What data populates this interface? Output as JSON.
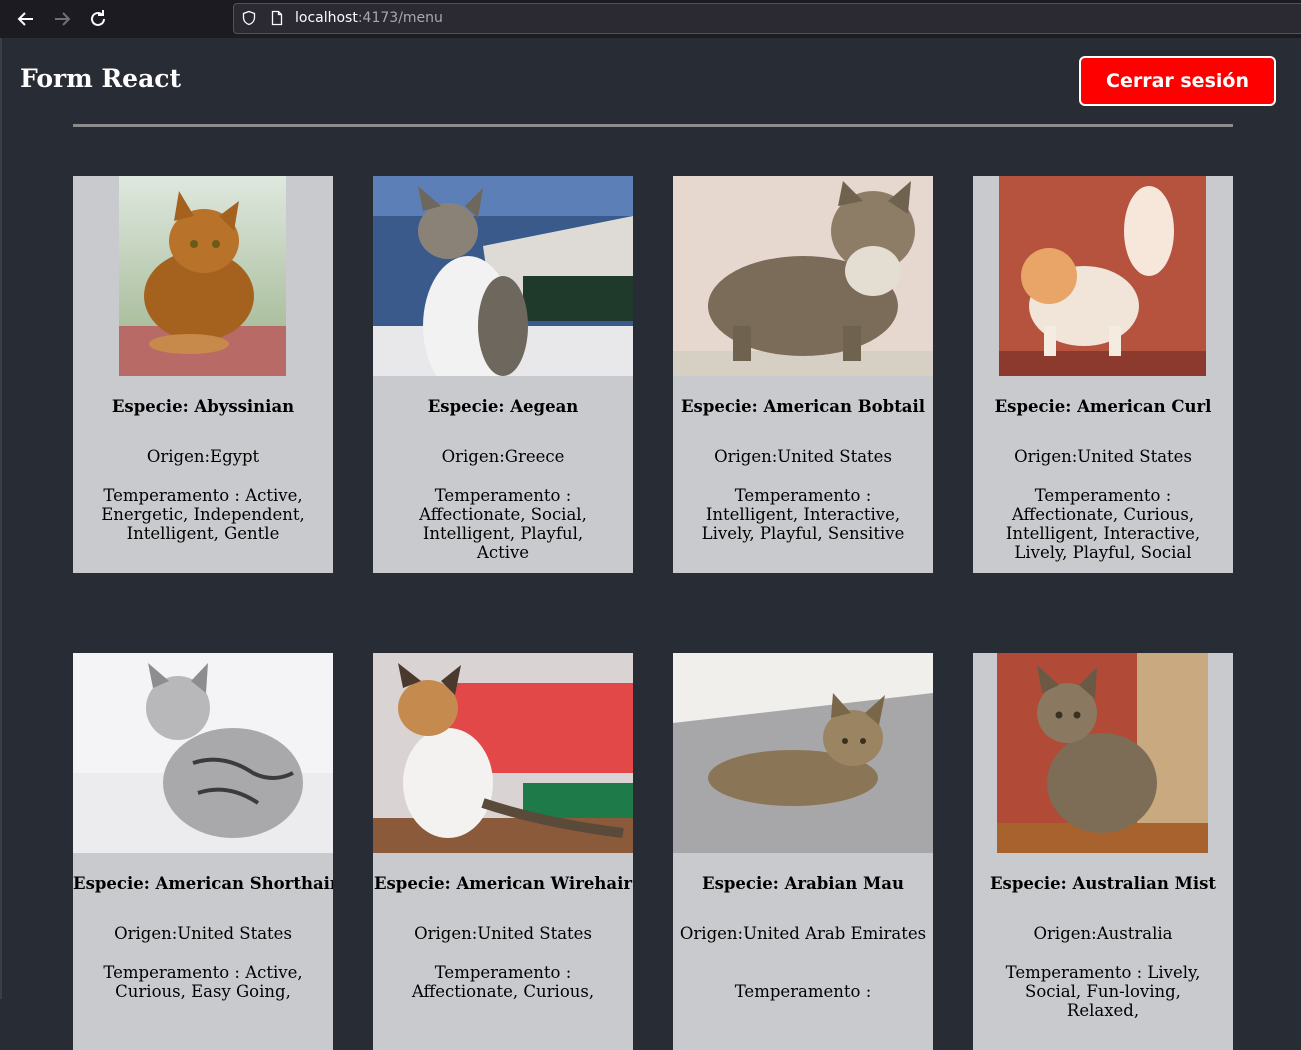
{
  "browser": {
    "back_icon": "arrow-left-icon",
    "forward_icon": "arrow-right-icon",
    "reload_icon": "reload-icon",
    "url_host": "localhost",
    "url_rest": ":4173/menu"
  },
  "header": {
    "title": "Form React",
    "logout_label": "Cerrar sesión",
    "logout_color": "#ff0000",
    "background_color": "#282c34"
  },
  "cards": [
    {
      "especie": "Especie: Abyssinian",
      "origen": "Origen:Egypt",
      "temperamento": "Temperamento : Active, Energetic, Independent, Intelligent, Gentle"
    },
    {
      "especie": "Especie: Aegean",
      "origen": "Origen:Greece",
      "temperamento": "Temperamento : Affectionate, Social, Intelligent, Playful, Active"
    },
    {
      "especie": "Especie: American Bobtail",
      "origen": "Origen:United States",
      "temperamento": "Temperamento : Intelligent, Interactive, Lively, Playful, Sensitive"
    },
    {
      "especie": "Especie: American Curl",
      "origen": "Origen:United States",
      "temperamento": "Temperamento : Affectionate, Curious, Intelligent, Interactive, Lively, Playful, Social"
    },
    {
      "especie": "Especie: American Shorthair",
      "origen": "Origen:United States",
      "temperamento": "Temperamento : Active, Curious, Easy Going,"
    },
    {
      "especie": "Especie: American Wirehair",
      "origen": "Origen:United States",
      "temperamento": "Temperamento : Affectionate, Curious,"
    },
    {
      "especie": "Especie: Arabian Mau",
      "origen": "Origen:United Arab Emirates",
      "temperamento": "Temperamento :"
    },
    {
      "especie": "Especie: Australian Mist",
      "origen": "Origen:Australia",
      "temperamento": "Temperamento : Lively, Social, Fun-loving, Relaxed,"
    }
  ]
}
